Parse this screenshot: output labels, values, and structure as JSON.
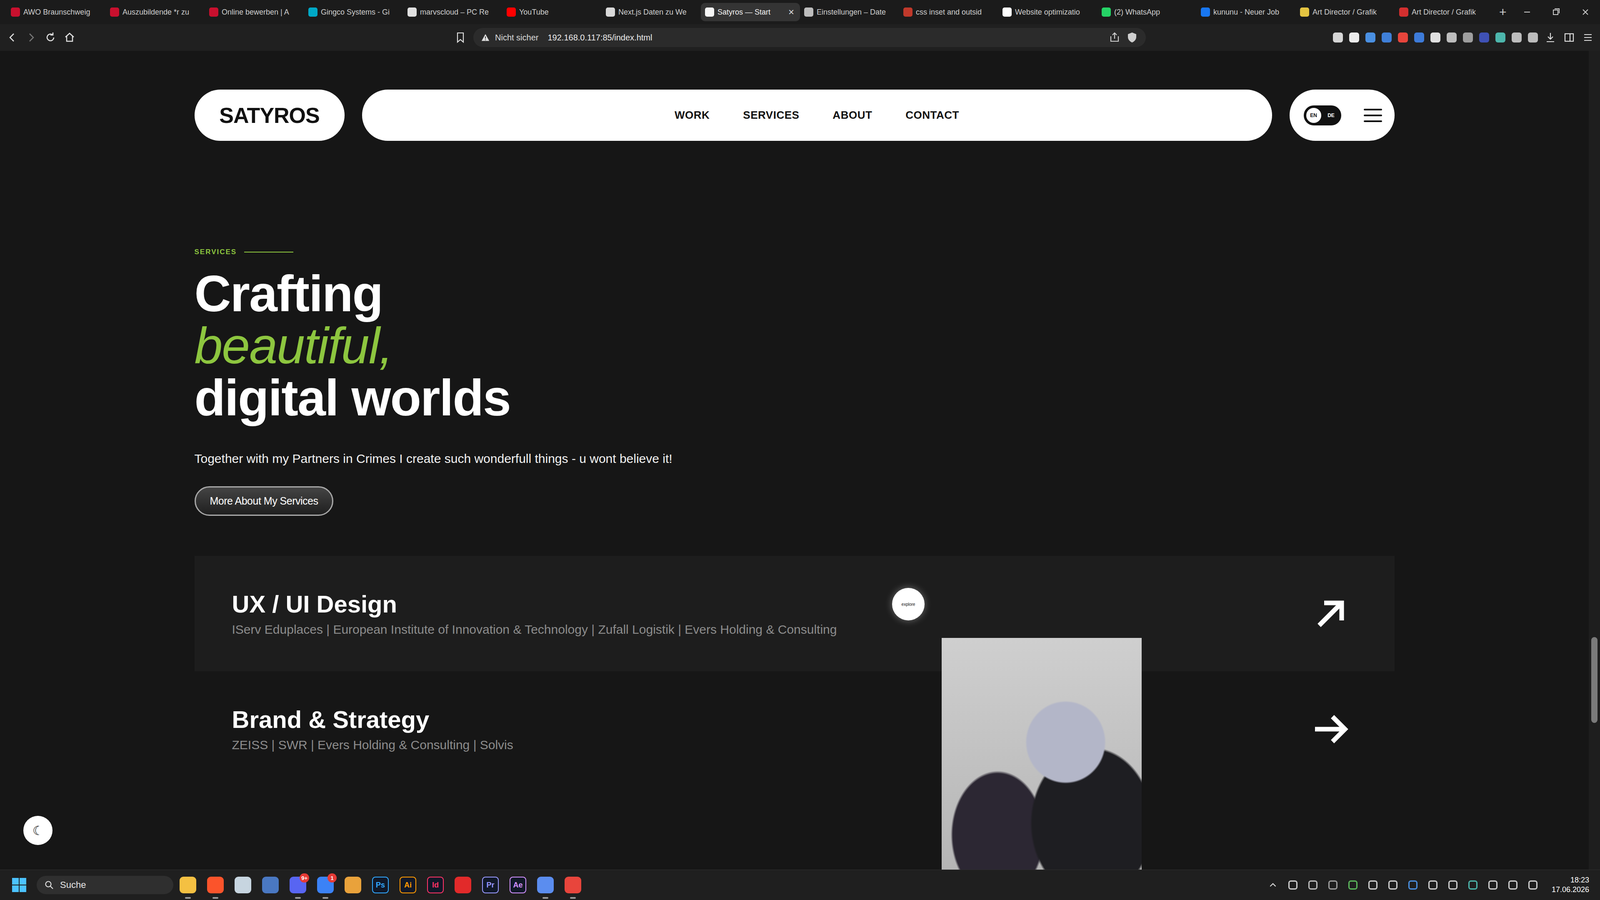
{
  "browser": {
    "tabs": [
      {
        "label": "AWO Braunschweig",
        "selected": false,
        "color": "#c8102e"
      },
      {
        "label": "Auszubildende *r zu",
        "selected": false,
        "color": "#c8102e"
      },
      {
        "label": "Online bewerben | A",
        "selected": false,
        "color": "#c8102e"
      },
      {
        "label": "Gingco Systems - Gi",
        "selected": false,
        "color": "#00a9c7"
      },
      {
        "label": "marvscloud – PC Re",
        "selected": false,
        "color": "#e0e0e0"
      },
      {
        "label": "YouTube",
        "selected": false,
        "color": "#ff0000"
      },
      {
        "label": "Next.js Daten zu We",
        "selected": false,
        "color": "#d9d9d9"
      },
      {
        "label": "Satyros — Start",
        "selected": true,
        "color": "#f5f5f5"
      },
      {
        "label": "Einstellungen – Date",
        "selected": false,
        "color": "#bdbdbd"
      },
      {
        "label": "css inset and outsid",
        "selected": false,
        "color": "#c0392b"
      },
      {
        "label": "Website optimizatio",
        "selected": false,
        "color": "#ffffff"
      },
      {
        "label": "(2) WhatsApp",
        "selected": false,
        "color": "#25d366"
      },
      {
        "label": "kununu - Neuer Job",
        "selected": false,
        "color": "#1877f2"
      },
      {
        "label": "Art Director / Grafik",
        "selected": false,
        "color": "#e4c441"
      },
      {
        "label": "Art Director / Grafik",
        "selected": false,
        "color": "#d32f2f"
      }
    ],
    "close": "×",
    "new_tab": "+",
    "address": {
      "security": "Nicht sicher",
      "url": "192.168.0.117:85/index.html"
    },
    "extensions": [
      {
        "color": "#d6d6d6"
      },
      {
        "color": "#ececec"
      },
      {
        "color": "#4a90e2"
      },
      {
        "color": "#3f7fd8"
      },
      {
        "color": "#e8453c"
      },
      {
        "color": "#3d7bd9"
      },
      {
        "color": "#e0e0e0"
      },
      {
        "color": "#bdbdbd"
      },
      {
        "color": "#9e9e9e"
      },
      {
        "color": "#3f51b5"
      },
      {
        "color": "#4db6ac"
      },
      {
        "color": "#bdbdbd"
      },
      {
        "color": "#bdbdbd"
      }
    ]
  },
  "page": {
    "logo": "SATYROS",
    "nav": [
      {
        "label": "WORK"
      },
      {
        "label": "SERVICES"
      },
      {
        "label": "ABOUT"
      },
      {
        "label": "CONTACT"
      }
    ],
    "language": [
      {
        "label": "EN",
        "selected": true
      },
      {
        "label": "DE",
        "selected": false
      }
    ],
    "eyebrow": "SERVICES",
    "heading": {
      "line1": "Crafting",
      "line2": "beautiful,",
      "line3": "digital worlds"
    },
    "intro": "Together with my Partners in Crimes I create such wonderfull things - u wont believe it!",
    "cta": "More About My Services",
    "services": [
      {
        "title": "UX / UI Design",
        "clients": "IServ Eduplaces | European Institute of Innovation & Technology | Zufall Logistik | Evers Holding & Consulting",
        "hovered": true
      },
      {
        "title": "Brand & Strategy",
        "clients": "ZEISS | SWR | Evers Holding & Consulting | Solvis",
        "hovered": false
      }
    ],
    "cursor": {
      "label": "explore"
    },
    "theme_toggle": "☾",
    "scrollbar": {
      "level": 0.8
    }
  },
  "taskbar": {
    "search": "Suche",
    "apps": [
      {
        "kind": "tile",
        "color": "#f4c042",
        "running": true
      },
      {
        "kind": "tile",
        "color": "#fb542b",
        "running": true
      },
      {
        "kind": "tile",
        "color": "#c7d5e0",
        "running": false
      },
      {
        "kind": "tile",
        "color": "#4a78c2",
        "running": false
      },
      {
        "kind": "tile",
        "color": "#5865f2",
        "running": true,
        "badge": "9+"
      },
      {
        "kind": "tile",
        "color": "#3b82f6",
        "running": true,
        "badge": "1"
      },
      {
        "kind": "tile",
        "color": "#e9a23b",
        "running": false
      },
      {
        "kind": "letters",
        "label": "Ps",
        "color": "#31a8ff",
        "running": false
      },
      {
        "kind": "letters",
        "label": "Ai",
        "color": "#ff9a00",
        "running": false
      },
      {
        "kind": "letters",
        "label": "Id",
        "color": "#ff3366",
        "running": false
      },
      {
        "kind": "tile",
        "color": "#e22a2a",
        "running": false
      },
      {
        "kind": "letters",
        "label": "Pr",
        "color": "#9999ff",
        "running": false
      },
      {
        "kind": "letters",
        "label": "Ae",
        "color": "#d291ff",
        "running": false
      },
      {
        "kind": "tile",
        "color": "#5b8def",
        "running": true
      },
      {
        "kind": "tile",
        "color": "#e8453c",
        "running": true
      }
    ],
    "tray": [
      {
        "color": "#cfcfcf"
      },
      {
        "color": "#bdbdbd"
      },
      {
        "color": "#9e9e9e"
      },
      {
        "color": "#5cb85c"
      },
      {
        "color": "#cfcfcf"
      },
      {
        "color": "#cfcfcf"
      },
      {
        "color": "#4a90e2"
      },
      {
        "color": "#cfcfcf"
      },
      {
        "color": "#cfcfcf"
      },
      {
        "color": "#4db6ac"
      },
      {
        "color": "#cfcfcf"
      },
      {
        "color": "#cfcfcf"
      },
      {
        "color": "#cfcfcf"
      }
    ],
    "time": "18:23",
    "date": "17.06.2026"
  }
}
